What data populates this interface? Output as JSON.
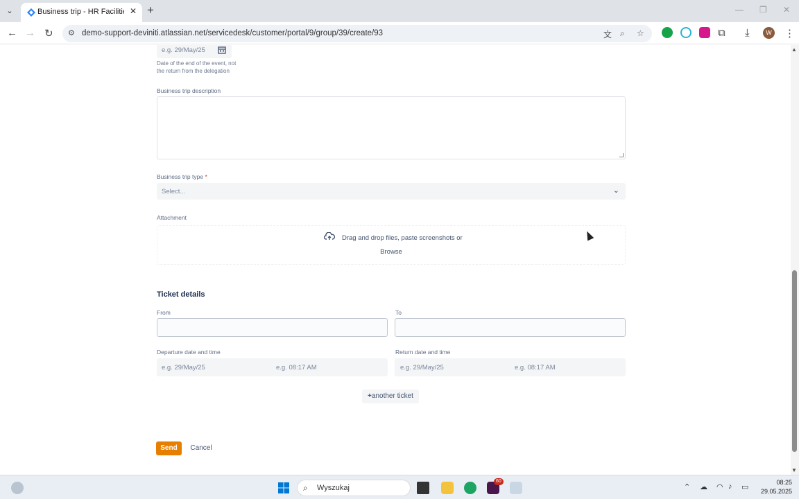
{
  "browser": {
    "tab_title": "Business trip - HR Facilities - Ji",
    "url": "demo-support-deviniti.atlassian.net/servicedesk/customer/portal/9/group/39/create/93",
    "profile_initial": "W"
  },
  "form": {
    "end_date": {
      "placeholder": "e.g. 29/May/25",
      "help": "Date of the end of the event, not the return from the delegation"
    },
    "description": {
      "label": "Business trip description",
      "value": ""
    },
    "trip_type": {
      "label": "Business trip type",
      "required_mark": "*",
      "placeholder": "Select..."
    },
    "attachment": {
      "label": "Attachment",
      "drop_text": "Drag and drop files, paste screenshots or",
      "browse_label": "Browse"
    },
    "ticket_details": {
      "heading": "Ticket details",
      "from_label": "From",
      "to_label": "To",
      "departure_label": "Departure date and time",
      "return_label": "Return date and time",
      "date_placeholder": "e.g. 29/May/25",
      "time_placeholder": "e.g. 08:17 AM",
      "add_ticket_label": "another ticket",
      "add_ticket_prefix": "+"
    },
    "send_label": "Send",
    "cancel_label": "Cancel"
  },
  "taskbar": {
    "search_text": "Wyszukaj",
    "badge": "60",
    "time": "08:25",
    "date": "29.05.2025"
  },
  "colors": {
    "send_button": "#e67e00",
    "required": "#de350b"
  }
}
